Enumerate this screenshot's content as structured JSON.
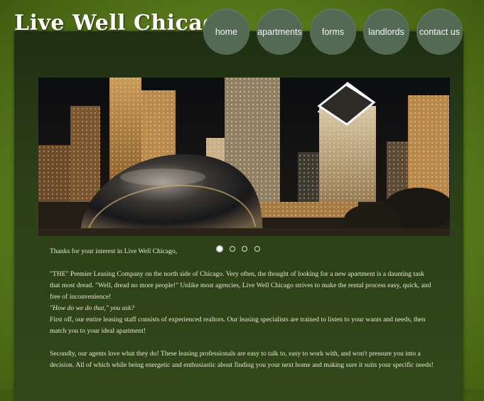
{
  "site": {
    "title": "Live Well Chicago"
  },
  "nav": {
    "items": [
      "home",
      "apartments",
      "forms",
      "landlords",
      "contact us"
    ]
  },
  "slider": {
    "slide_count": 4,
    "active_index": 0
  },
  "content": {
    "greeting": "Thanks for your interest in Live Well Chicago,",
    "intro": "\"THE\" Premier Leasing Company on the north side of Chicago. Very often, the thought of looking for a new apartment is a daunting task that most dread. \"Well, dread no more people!\" Unlike most agencies, Live Well Chicago strives to make the rental process easy, quick, and free of inconvenience!",
    "question": "\"How do we do that,\" you ask?",
    "first": "First off, our entire leasing staff consists of experienced realtors. Our leasing specialists are trained to listen to your wants and needs, then match you to your ideal apartment!",
    "second": "Secondly, our agents love what they do! These leasing professionals are easy to talk to, easy to work with, and won't pressure you into a decision. All of which while being energetic and enthusiastic about finding you your next home and making sure it suits your specific needs!"
  },
  "colors": {
    "background": "#6b8a22",
    "panel": "#2c3f18",
    "nav_button": "#556a55",
    "text": "#ece8d8"
  }
}
